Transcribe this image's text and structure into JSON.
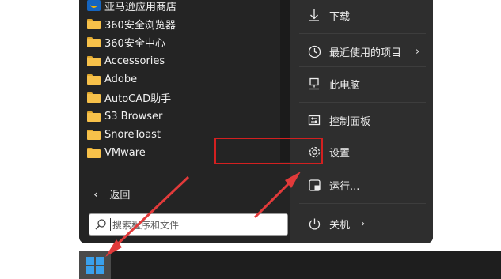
{
  "start_menu": {
    "apps": [
      {
        "label": "亚马逊应用商店",
        "icon": "store-icon"
      },
      {
        "label": "360安全浏览器",
        "icon": "folder-icon"
      },
      {
        "label": "360安全中心",
        "icon": "folder-icon"
      },
      {
        "label": "Accessories",
        "icon": "folder-icon"
      },
      {
        "label": "Adobe",
        "icon": "folder-icon"
      },
      {
        "label": "AutoCAD助手",
        "icon": "folder-icon"
      },
      {
        "label": "S3 Browser",
        "icon": "folder-icon"
      },
      {
        "label": "SnoreToast",
        "icon": "folder-icon"
      },
      {
        "label": "VMware",
        "icon": "folder-icon"
      }
    ],
    "back_label": "返回",
    "search": {
      "placeholder": "搜索程序和文件"
    },
    "system_items": {
      "downloads": "下载",
      "recent": "最近使用的项目",
      "this_pc": "此电脑",
      "control_panel": "控制面板",
      "settings": "设置",
      "run": "运行...",
      "shutdown": "关机"
    }
  },
  "colors": {
    "menu_bg": "#242424",
    "right_pane_bg": "#2e2e2e",
    "highlight": "#d32020",
    "annotation_arrow": "#e23a3a",
    "folder": "#f7c14a",
    "windows_blue": "#3aa0ec"
  }
}
